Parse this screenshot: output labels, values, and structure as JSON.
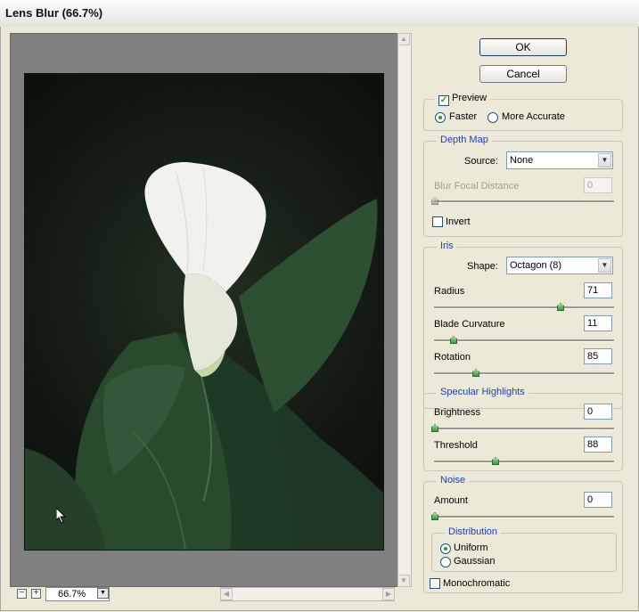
{
  "window": {
    "title": "Lens Blur (66.7%)"
  },
  "buttons": {
    "ok": "OK",
    "cancel": "Cancel"
  },
  "preview_group": {
    "preview_label": "Preview",
    "preview_checked": true,
    "faster_label": "Faster",
    "more_accurate_label": "More Accurate",
    "selected": "Faster"
  },
  "depth_map": {
    "title": "Depth Map",
    "source_label": "Source:",
    "source_value": "None",
    "blur_focal_label": "Blur Focal Distance",
    "blur_focal_value": "0",
    "invert_label": "Invert",
    "invert_checked": false
  },
  "iris": {
    "title": "Iris",
    "shape_label": "Shape:",
    "shape_value": "Octagon (8)",
    "radius_label": "Radius",
    "radius_value": "71",
    "blade_label": "Blade Curvature",
    "blade_value": "11",
    "rotation_label": "Rotation",
    "rotation_value": "85"
  },
  "specular": {
    "title": "Specular Highlights",
    "brightness_label": "Brightness",
    "brightness_value": "0",
    "threshold_label": "Threshold",
    "threshold_value": "88"
  },
  "noise": {
    "title": "Noise",
    "amount_label": "Amount",
    "amount_value": "0",
    "distribution_title": "Distribution",
    "uniform_label": "Uniform",
    "gaussian_label": "Gaussian",
    "distribution_selected": "Uniform",
    "mono_label": "Monochromatic",
    "mono_checked": false
  },
  "zoom": {
    "value": "66.7%"
  },
  "colors": {
    "legend": "#1a3fbf",
    "accent_green": "#21a121"
  }
}
